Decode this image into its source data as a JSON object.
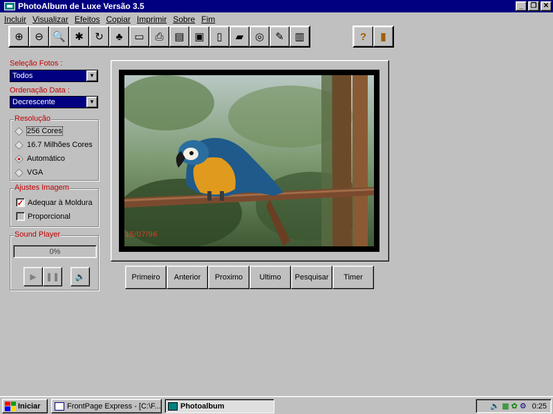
{
  "window": {
    "title": "PhotoAlbum de Luxe Versão 3.5"
  },
  "menu": [
    "Incluir",
    "Visualizar",
    "Efeitos",
    "Copiar",
    "Imprimir",
    "Sobre",
    "Fim"
  ],
  "toolbar": [
    {
      "icon": "zoom-in-icon",
      "glyph": "⊕"
    },
    {
      "icon": "zoom-out-icon",
      "glyph": "⊖"
    },
    {
      "icon": "search-icon",
      "glyph": "🔍"
    },
    {
      "icon": "effects-icon",
      "glyph": "✱"
    },
    {
      "icon": "rotate-icon",
      "glyph": "↻"
    },
    {
      "icon": "tree-icon",
      "glyph": "♣"
    },
    {
      "icon": "note-icon",
      "glyph": "▭"
    },
    {
      "icon": "print-icon",
      "glyph": "⎙"
    },
    {
      "icon": "print-preview-icon",
      "glyph": "▤"
    },
    {
      "icon": "monitor-icon",
      "glyph": "▣"
    },
    {
      "icon": "new-page-icon",
      "glyph": "▯"
    },
    {
      "icon": "folder-icon",
      "glyph": "▰"
    },
    {
      "icon": "cd-icon",
      "glyph": "◎"
    },
    {
      "icon": "pencil-icon",
      "glyph": "✎"
    },
    {
      "icon": "film-icon",
      "glyph": "▥"
    }
  ],
  "toolbar2": [
    {
      "icon": "help-icon",
      "glyph": "?"
    },
    {
      "icon": "exit-door-icon",
      "glyph": "▮"
    }
  ],
  "sidebar": {
    "selection_label": "Seleção Fotos :",
    "selection_value": "Todos",
    "order_label": "Ordenação Data :",
    "order_value": "Decrescente",
    "resolution_label": "Resolução",
    "resolution_options": [
      {
        "label": "256 Cores",
        "selected": false
      },
      {
        "label": "16.7 Milhões Cores",
        "selected": false
      },
      {
        "label": "Automático",
        "selected": true
      },
      {
        "label": "VGA",
        "selected": false
      }
    ],
    "adjust_label": "Ajustes  Imagem",
    "adjust_options": [
      {
        "label": "Adequar à Moldura",
        "checked": true
      },
      {
        "label": "Proporcional",
        "checked": false
      }
    ],
    "sound_label": "Sound Player",
    "sound_progress": "0%"
  },
  "photo": {
    "date_stamp": "15/07/96"
  },
  "nav_buttons": [
    "Primeiro",
    "Anterior",
    "Proximo",
    "Ultimo",
    "Pesquisar",
    "Timer"
  ],
  "taskbar": {
    "start_label": "Iniciar",
    "tasks": [
      {
        "label": "FrontPage Express - [C:\\F...",
        "active": false
      },
      {
        "label": "Photoalbum",
        "active": true
      }
    ],
    "clock": "0:25"
  }
}
